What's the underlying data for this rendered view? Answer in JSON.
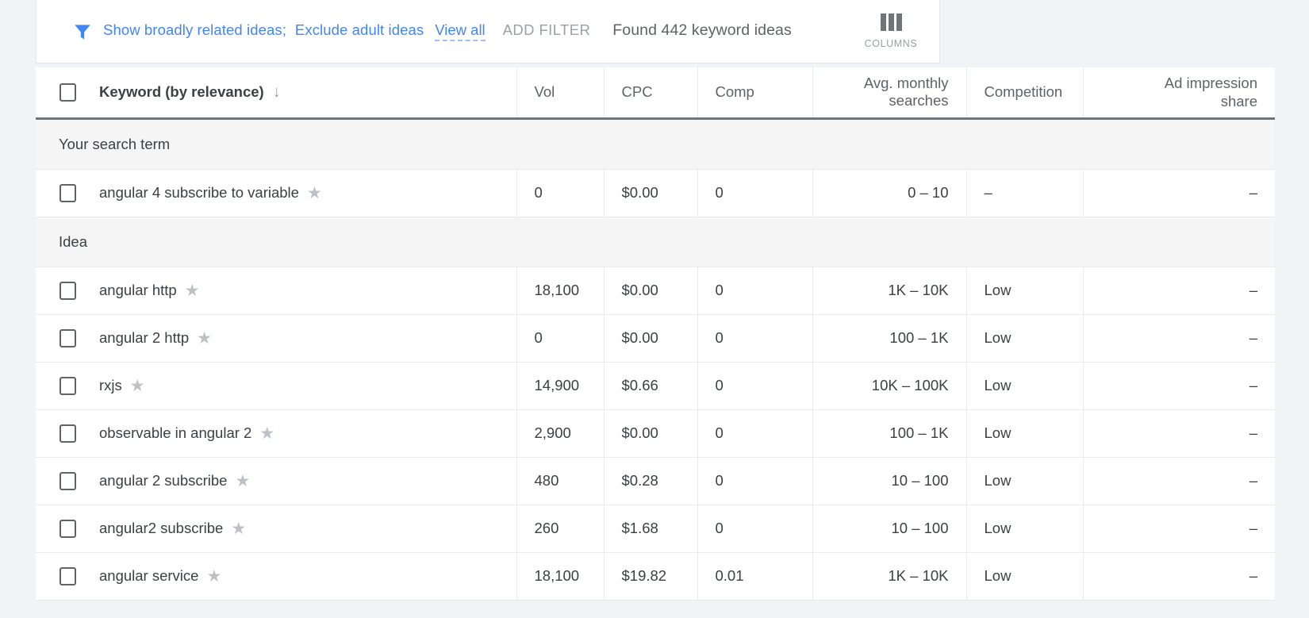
{
  "toolbar": {
    "filter_icon": "filter-funnel-icon",
    "chips": [
      {
        "label": "Show broadly related ideas",
        "separator": ";"
      },
      {
        "label": "Exclude adult ideas",
        "separator": ""
      }
    ],
    "view_all_label": "View all",
    "add_filter_label": "ADD FILTER",
    "found_text": "Found 442 keyword ideas",
    "columns_label": "COLUMNS",
    "columns_icon": "columns-icon",
    "accent_color": "#4285f4"
  },
  "table": {
    "headers": {
      "keyword": "Keyword (by relevance)",
      "sort_arrow": "↓",
      "vol": "Vol",
      "cpc": "CPC",
      "comp": "Comp",
      "avg_monthly_searches": "Avg. monthly searches",
      "competition": "Competition",
      "ad_impression_share_line1": "Ad impression",
      "ad_impression_share_line2": "share"
    },
    "groups": [
      {
        "label": "Your search term",
        "rows": [
          {
            "keyword": "angular 4 subscribe to variable",
            "vol": "0",
            "cpc": "$0.00",
            "comp": "0",
            "avg_monthly_searches": "0 – 10",
            "competition": "–",
            "ad_impression_share": "–"
          }
        ]
      },
      {
        "label": "Idea",
        "rows": [
          {
            "keyword": "angular http",
            "vol": "18,100",
            "cpc": "$0.00",
            "comp": "0",
            "avg_monthly_searches": "1K – 10K",
            "competition": "Low",
            "ad_impression_share": "–"
          },
          {
            "keyword": "angular 2 http",
            "vol": "0",
            "cpc": "$0.00",
            "comp": "0",
            "avg_monthly_searches": "100 – 1K",
            "competition": "Low",
            "ad_impression_share": "–"
          },
          {
            "keyword": "rxjs",
            "vol": "14,900",
            "cpc": "$0.66",
            "comp": "0",
            "avg_monthly_searches": "10K – 100K",
            "competition": "Low",
            "ad_impression_share": "–"
          },
          {
            "keyword": "observable in angular 2",
            "vol": "2,900",
            "cpc": "$0.00",
            "comp": "0",
            "avg_monthly_searches": "100 – 1K",
            "competition": "Low",
            "ad_impression_share": "–"
          },
          {
            "keyword": "angular 2 subscribe",
            "vol": "480",
            "cpc": "$0.28",
            "comp": "0",
            "avg_monthly_searches": "10 – 100",
            "competition": "Low",
            "ad_impression_share": "–"
          },
          {
            "keyword": "angular2 subscribe",
            "vol": "260",
            "cpc": "$1.68",
            "comp": "0",
            "avg_monthly_searches": "10 – 100",
            "competition": "Low",
            "ad_impression_share": "–"
          },
          {
            "keyword": "angular service",
            "vol": "18,100",
            "cpc": "$19.82",
            "comp": "0.01",
            "avg_monthly_searches": "1K – 10K",
            "competition": "Low",
            "ad_impression_share": "–"
          }
        ]
      }
    ],
    "star_icon": "star-outline-icon",
    "checkbox_icon": "checkbox-unchecked-icon"
  }
}
